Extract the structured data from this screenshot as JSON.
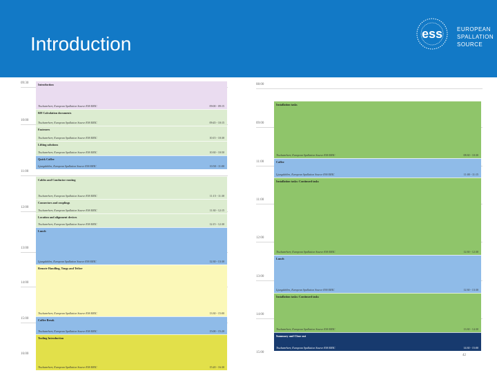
{
  "header": {
    "title": "Introduction",
    "logo_lines": [
      "EUROPEAN",
      "SPALLATION",
      "SOURCE"
    ],
    "logo_mark": "ess",
    "background": "#1279c6"
  },
  "colors": {
    "purple": "#eadcf0",
    "green_light": "#dcecd0",
    "blue": "#8fbbe8",
    "yellow": "#fbf8b8",
    "yellow_strong": "#e2e04a",
    "green": "#8fc56a",
    "navy": "#173a6e"
  },
  "left_times": [
    "09:30",
    "10:00",
    "11:00",
    "12:00",
    "13:00",
    "14:00",
    "15:00",
    "16:00"
  ],
  "right_times": [
    "08:00",
    "09:00",
    "11:00",
    "11:00",
    "12:00",
    "13:00",
    "14:00",
    "15:00"
  ],
  "left_column": [
    {
      "title": "Introduction",
      "speaker": "Tischamrherr, European Spallation Source ESS ERIC",
      "time": "09:00 - 09:15",
      "color": "purple"
    },
    {
      "title": "RH Calculation documents",
      "speaker": "Tischamrherr, European Spallation Source ESS ERIC",
      "time": "09:45 - 10:15",
      "color": "green_light"
    },
    {
      "title": "Fasteners",
      "speaker": "Tischamrherr, European Spallation Source ESS ERIC",
      "time": "10:15 - 10:30",
      "color": "green_light"
    },
    {
      "title": "Lifting solutions",
      "speaker": "Tischamrherr, European Spallation Source ESS ERIC",
      "time": "10:30 - 10:50",
      "color": "green_light"
    },
    {
      "title": "Quick Coffee",
      "speaker": "Ljungdahlen, European Spallation Source ESS ERIC",
      "time": "10:50 - 11:00",
      "color": "blue"
    },
    {
      "title": "Cables and Conductor routing",
      "speaker": "Tischamrherr, European Spallation Source ESS ERIC",
      "time": "11:15 - 11:30",
      "color": "green_light"
    },
    {
      "title": "Connectors and couplings",
      "speaker": "Tischamrherr, European Spallation Source ESS ERIC",
      "time": "11:30 - 12:15",
      "color": "green_light"
    },
    {
      "title": "Location and alignment devices",
      "speaker": "Tischamrherr, European Spallation Source ESS ERIC",
      "time": "12:15 - 12:30",
      "color": "green_light"
    },
    {
      "title": "Lunch",
      "speaker": "Ljungdahlen, European Spallation Source ESS ERIC",
      "time": "12:30 - 13:30",
      "color": "blue"
    },
    {
      "title": "Remote Handling, Tongs and Tether",
      "speaker": "Tischamrherr, European Spallation Source ESS ERIC",
      "time": "13:30 - 15:00",
      "color": "yellow"
    },
    {
      "title": "Coffee Break",
      "speaker": "Tischamrherr, European Spallation Source ESS ERIC",
      "time": "15:00 - 15:20",
      "color": "blue"
    },
    {
      "title": "Tooling Introduction",
      "speaker": "Tischamrherr, European Spallation Source ESS ERIC",
      "time": "15:20 - 16:30",
      "color": "yellow_strong"
    }
  ],
  "right_column": [
    {
      "title": "Installation tasks",
      "speaker": "Tischamrherr, European Spallation Source ESS ERIC",
      "time": "08:30 - 10:30",
      "color": "green"
    },
    {
      "title": "Coffee",
      "speaker": "Ljungdahlen, European Spallation Source ESS ERIC",
      "time": "11:00 - 11:15",
      "color": "blue"
    },
    {
      "title": "Installation tasks: Continued tasks",
      "speaker": "Tischamrherr, European Spallation Source ESS ERIC",
      "time": "12:30 - 12:30",
      "color": "green"
    },
    {
      "title": "Lunch",
      "speaker": "Ljungdahlen, European Spallation Source ESS ERIC",
      "time": "12:30 - 13:30",
      "color": "blue"
    },
    {
      "title": "Installation tasks: Continued tasks",
      "speaker": "Tischamrherr, European Spallation Source ESS ERIC",
      "time": "13:30 - 14:30",
      "color": "green"
    },
    {
      "title": "Summary and Close out",
      "speaker": "Tischamrherr, European Spallation Source ESS ERIC",
      "time": "14:30 - 15:00",
      "color": "navy"
    }
  ],
  "page_number": "42"
}
